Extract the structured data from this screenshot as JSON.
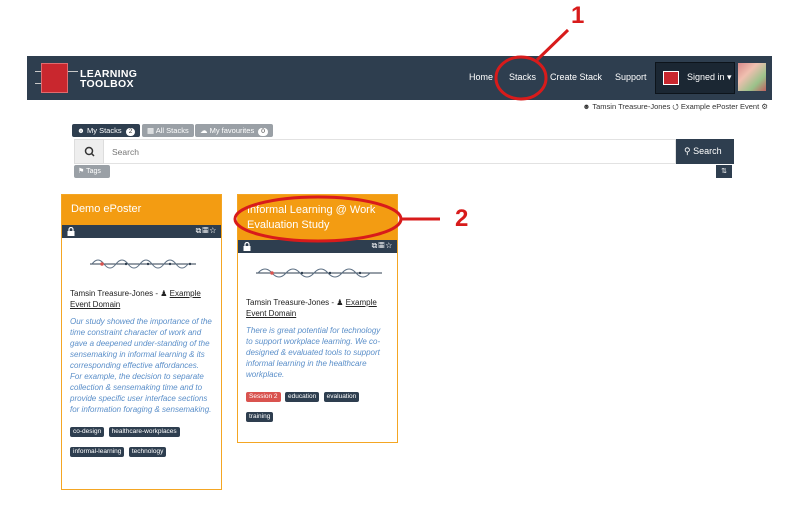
{
  "navbar": {
    "logo_text_1": "LEARNING",
    "logo_text_2": "TOOLBOX",
    "links": [
      "Home",
      "Stacks",
      "Create Stack",
      "Support"
    ],
    "signed_in_label": "Signed in ▾"
  },
  "user_line": "☻ Tamsin Treasure-Jones  ⭯ Example ePoster Event ⚙",
  "filters": {
    "my_stacks": "My Stacks",
    "my_stacks_count": "2",
    "all_stacks": "All Stacks",
    "my_favourites": "My favourites",
    "my_favourites_count": "0"
  },
  "search": {
    "placeholder": "Search",
    "button_label": "Search",
    "tags_label": "Tags"
  },
  "cards": [
    {
      "title": "Demo ePoster",
      "author": "Tamsin Treasure-Jones - ",
      "domain_1": "Example",
      "domain_2": "Event Domain",
      "description": "Our study showed the importance of the time constraint character of work and gave a deepened under-standing of the sensemaking in informal learning & its corresponding effective affordances. For example, the decision to separate collection & sensemaking time and to provide specific user interface sections for information foraging & sensemaking.",
      "tags": [
        "co-design",
        "healthcare-workplaces",
        "informal-learning",
        "technology"
      ]
    },
    {
      "title": "Informal Learning @ Work Evaluation Study",
      "author": "Tamsin Treasure-Jones - ",
      "domain_1": "Example",
      "domain_2": "Event Domain",
      "description": "There is great potential for technology to support workplace learning. We co-designed & evaluated tools to support informal learning in the healthcare workplace.",
      "tags": [
        "Session 2",
        "education",
        "evaluation",
        "training"
      ]
    }
  ],
  "annotations": {
    "label_1": "1",
    "label_2": "2",
    "color": "#d81b1b"
  }
}
